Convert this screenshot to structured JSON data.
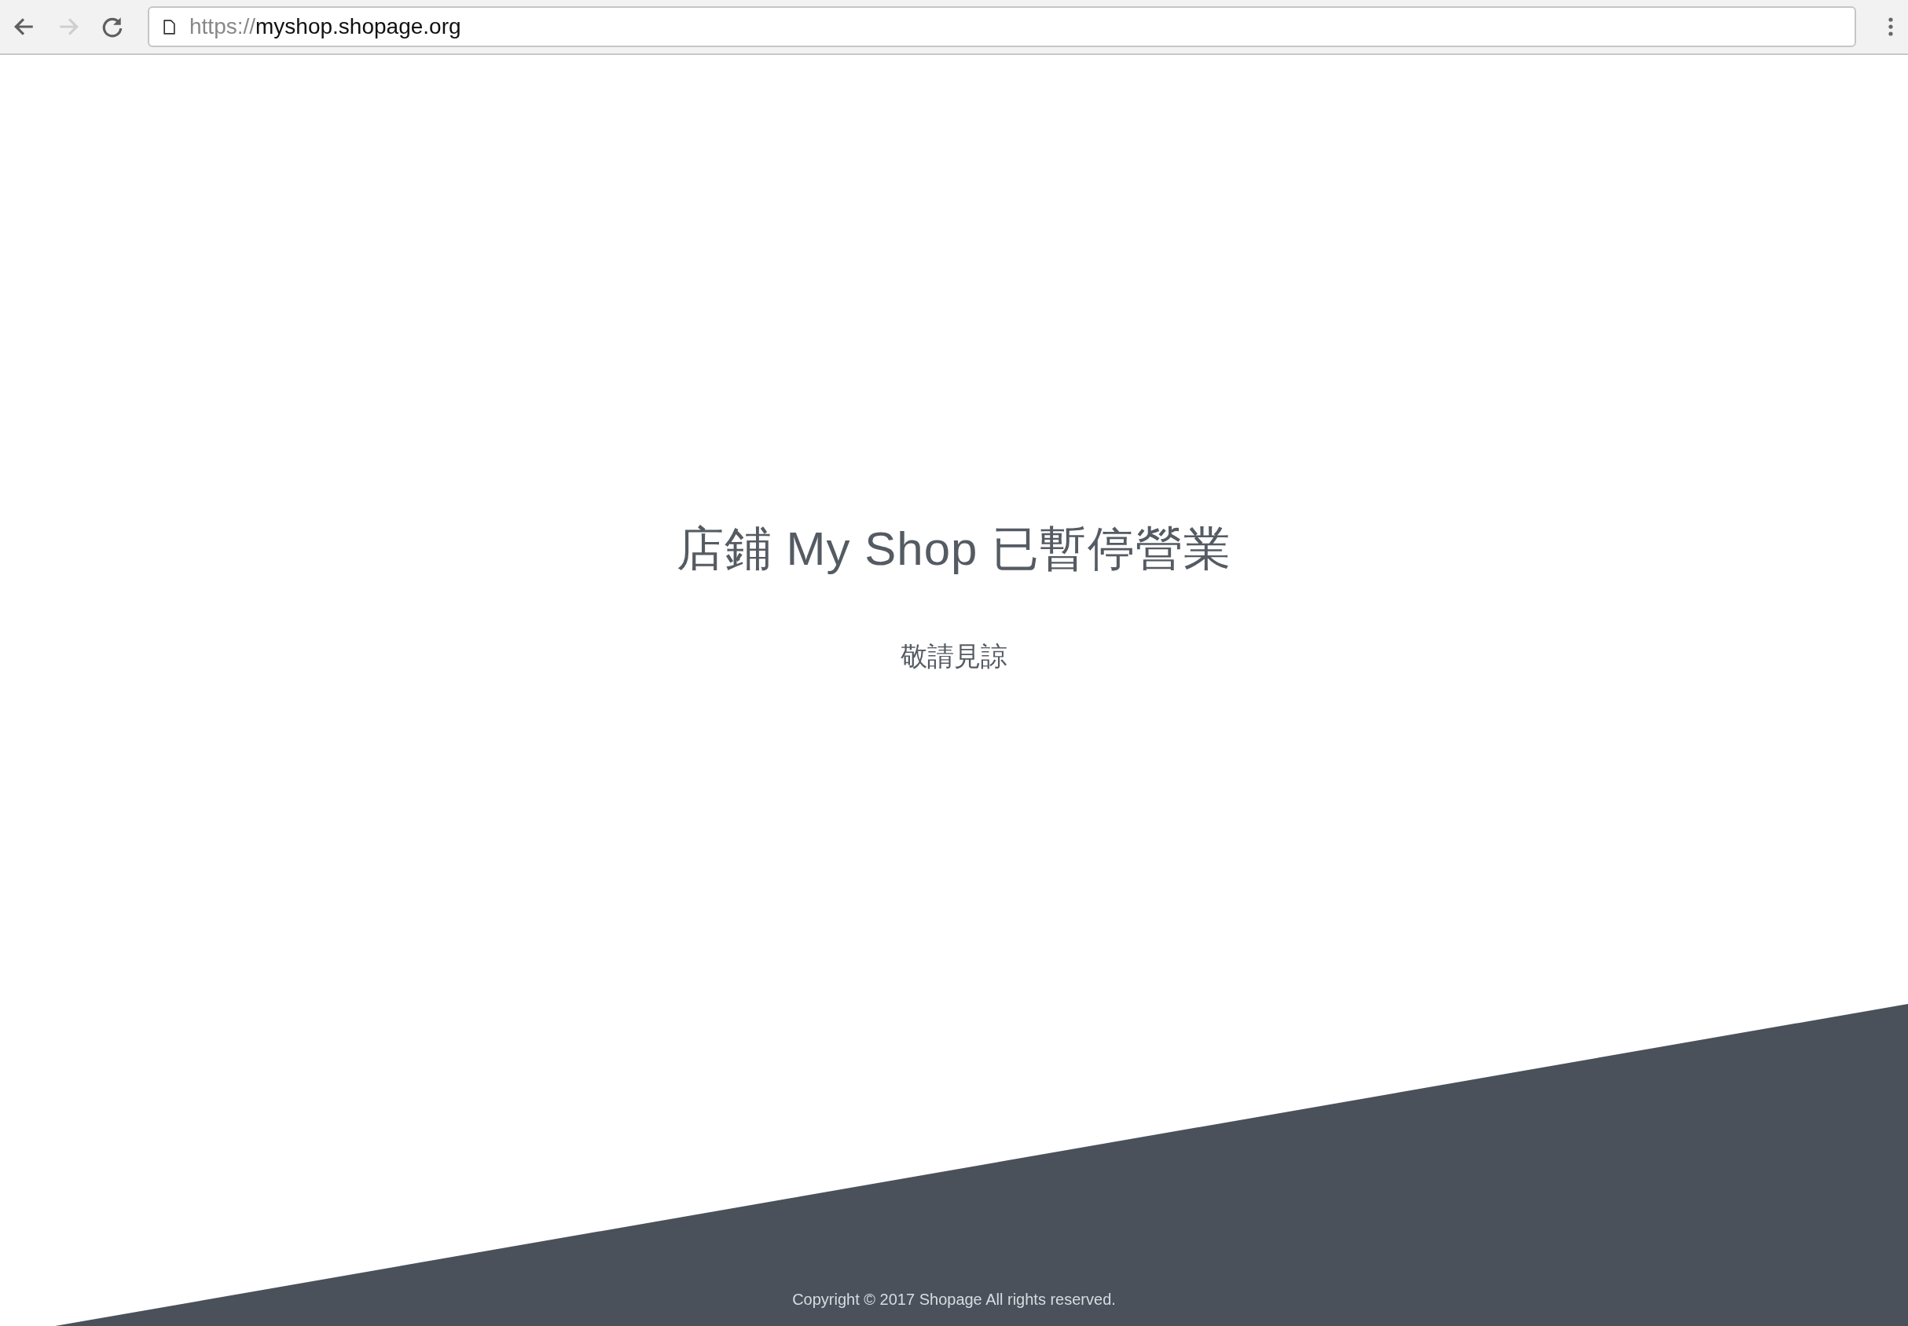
{
  "browser": {
    "url_scheme": "https://",
    "url_host": "myshop.shopage.org",
    "back_disabled": false,
    "forward_disabled": true
  },
  "page": {
    "title": "店鋪 My Shop 已暫停營業",
    "subtitle": "敬請見諒"
  },
  "footer": {
    "copyright": "Copyright © 2017 Shopage All rights reserved."
  }
}
